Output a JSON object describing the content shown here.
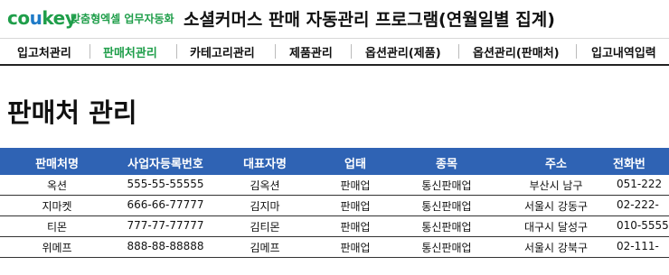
{
  "header": {
    "logo_co": "co",
    "logo_u": "u",
    "logo_key": "key",
    "tagline": "맞춤형엑셀 업무자동화",
    "title": "소셜커머스 판매 자동관리 프로그램(연월일별 집계)"
  },
  "nav": {
    "items": [
      {
        "label": "입고처관리"
      },
      {
        "label": "판매처관리"
      },
      {
        "label": "카테고리관리"
      },
      {
        "label": "제품관리"
      },
      {
        "label": "옵션관리(제품)"
      },
      {
        "label": "옵션관리(판매처)"
      },
      {
        "label": "입고내역입력"
      }
    ],
    "active_index": 1
  },
  "page": {
    "title": "판매처 관리"
  },
  "table": {
    "headers": [
      "판매처명",
      "사업자등록번호",
      "대표자명",
      "업태",
      "종목",
      "주소",
      "전화번"
    ],
    "rows": [
      [
        "옥션",
        "555-55-55555",
        "김옥션",
        "판매업",
        "통신판매업",
        "부산시 남구",
        "051-222"
      ],
      [
        "지마켓",
        "666-66-77777",
        "김지마",
        "판매업",
        "통신판매업",
        "서울시 강동구",
        "02-222-"
      ],
      [
        "티몬",
        "777-77-77777",
        "김티몬",
        "판매업",
        "통신판매업",
        "대구시 달성구",
        "010-5555"
      ],
      [
        "위메프",
        "888-88-88888",
        "김메프",
        "판매업",
        "통신판매업",
        "서울시 강북구",
        "02-111-"
      ]
    ]
  },
  "colors": {
    "brand_green": "#1f9e4a",
    "brand_blue": "#1f7bc8",
    "table_header": "#2f63b4"
  }
}
